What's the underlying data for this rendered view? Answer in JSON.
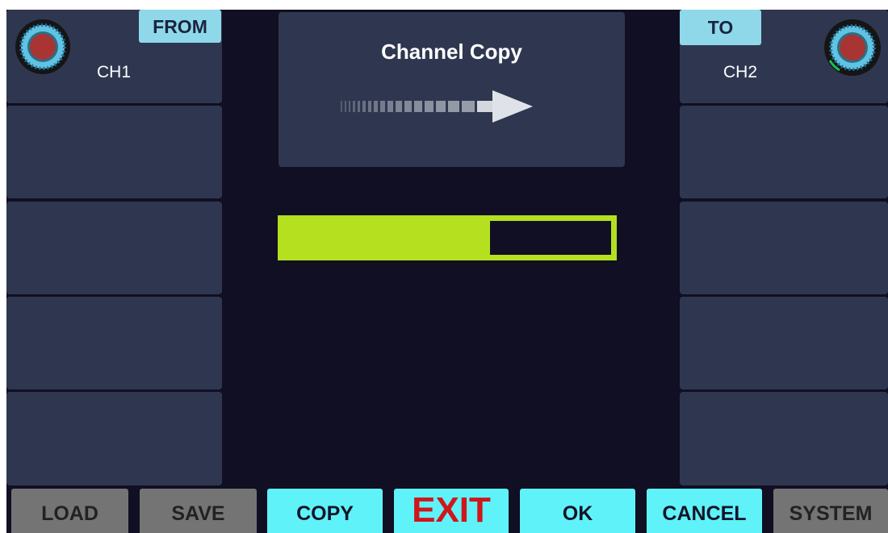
{
  "title": "Channel Copy",
  "source": {
    "tag": "FROM",
    "channel": "CH1"
  },
  "target": {
    "tag": "TO",
    "channel": "CH2"
  },
  "progress": {
    "percent": 63
  },
  "buttons": {
    "load": "LOAD",
    "save": "SAVE",
    "copy": "COPY",
    "exit": "EXIT",
    "ok": "OK",
    "cancel": "CANCEL",
    "system": "SYSTEM"
  },
  "colors": {
    "screen_bg": "#100f23",
    "panel": "#2f3750",
    "tag": "#8fd8ea",
    "progress_fill": "#b4e020",
    "button_active": "#5ff2f8",
    "button_inactive": "#747474",
    "exit_text": "#d0161c",
    "knob_center": "#a83434",
    "knob_ring": "#62c2e2"
  },
  "icons": {
    "source_knob": "rotary-knob-icon",
    "target_knob": "rotary-knob-icon",
    "copy_direction": "arrow-right-icon"
  }
}
